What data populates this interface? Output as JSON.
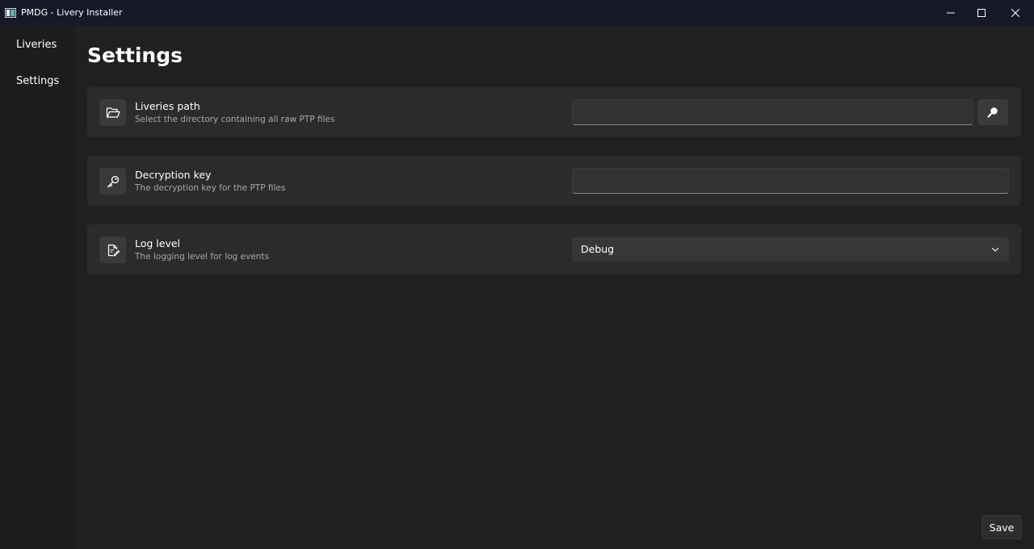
{
  "window": {
    "title": "PMDG - Livery Installer"
  },
  "nav": {
    "items": [
      {
        "label": "Liveries"
      },
      {
        "label": "Settings"
      }
    ]
  },
  "page": {
    "title": "Settings"
  },
  "settings": {
    "liveries_path": {
      "title": "Liveries path",
      "description": "Select the directory containing all raw PTP files",
      "value": "",
      "icon": "folder-icon",
      "browse_icon": "search-icon"
    },
    "decryption_key": {
      "title": "Decryption key",
      "description": "The decryption key for the PTP files",
      "value": "",
      "icon": "key-icon"
    },
    "log_level": {
      "title": "Log level",
      "description": "The logging level for log events",
      "selected": "Debug",
      "icon": "edit-document-icon"
    }
  },
  "actions": {
    "save_label": "Save"
  },
  "colors": {
    "titlebar": "#15192a",
    "background": "#202020",
    "card": "#2b2b2b",
    "nav": "#1c1c1c"
  }
}
